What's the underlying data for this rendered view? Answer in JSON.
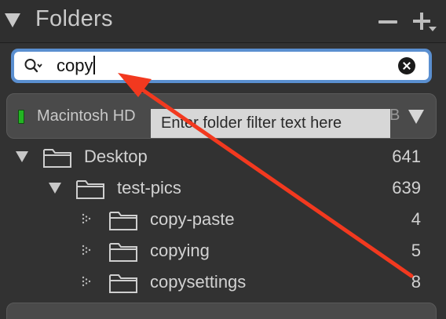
{
  "header": {
    "title": "Folders",
    "minus_icon": "minus-icon",
    "plus_icon": "plus-dropdown-icon"
  },
  "search": {
    "value": "copy",
    "icon": "magnifier-with-dropdown-icon",
    "clear_icon": "clear-x-icon",
    "focus_color": "#5a8fd0"
  },
  "volume": {
    "name": "Macintosh HD",
    "size_suffix": "B",
    "status_color": "#23b523"
  },
  "tooltip": {
    "text": "Enter folder filter text here"
  },
  "tree": [
    {
      "label": "Desktop",
      "count": "641"
    },
    {
      "label": "test-pics",
      "count": "639"
    },
    {
      "label": "copy-paste",
      "count": "4"
    },
    {
      "label": "copying",
      "count": "5"
    },
    {
      "label": "copysettings",
      "count": "8"
    }
  ],
  "annotation": {
    "color": "#f2391f"
  }
}
